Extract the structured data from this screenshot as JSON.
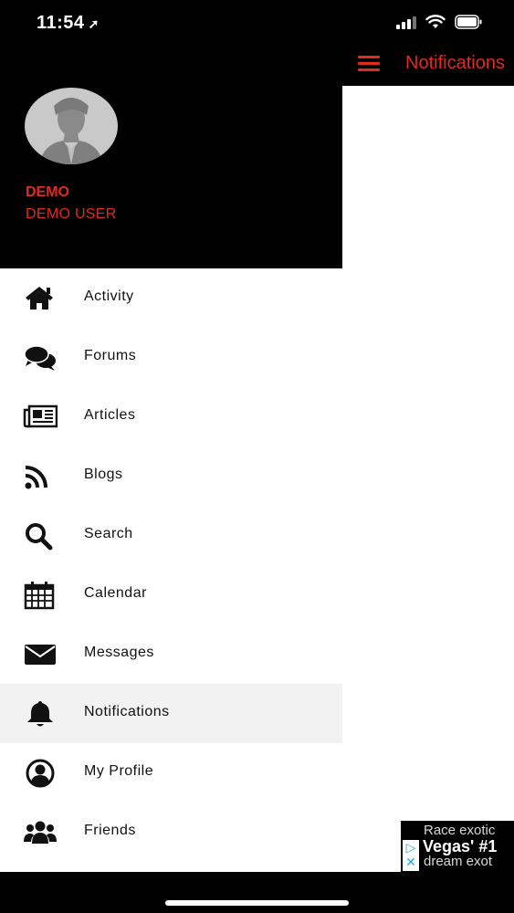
{
  "status_bar": {
    "time": "11:54",
    "location_icon": "location-arrow-icon",
    "signal_icon": "cellular-signal-icon",
    "wifi_icon": "wifi-icon",
    "battery_icon": "battery-icon"
  },
  "header": {
    "title": "Notifications",
    "menu_icon": "hamburger-menu-icon"
  },
  "user": {
    "name": "DEMO",
    "subtitle": "DEMO USER"
  },
  "menu": {
    "items": [
      {
        "label": "Activity",
        "icon": "home-icon"
      },
      {
        "label": "Forums",
        "icon": "comments-icon"
      },
      {
        "label": "Articles",
        "icon": "newspaper-icon"
      },
      {
        "label": "Blogs",
        "icon": "rss-icon"
      },
      {
        "label": "Search",
        "icon": "search-icon"
      },
      {
        "label": "Calendar",
        "icon": "calendar-icon"
      },
      {
        "label": "Messages",
        "icon": "envelope-icon"
      },
      {
        "label": "Notifications",
        "icon": "bell-icon"
      },
      {
        "label": "My Profile",
        "icon": "user-circle-icon"
      },
      {
        "label": "Friends",
        "icon": "users-icon"
      }
    ],
    "active_label": "Notifications"
  },
  "ad": {
    "line1": "Race exotic",
    "line2": "Vegas' #1",
    "line3": "dream exot"
  },
  "colors": {
    "accent": "#e02b20",
    "drawer_header": "#000000",
    "active_row": "#f2f2f2"
  }
}
